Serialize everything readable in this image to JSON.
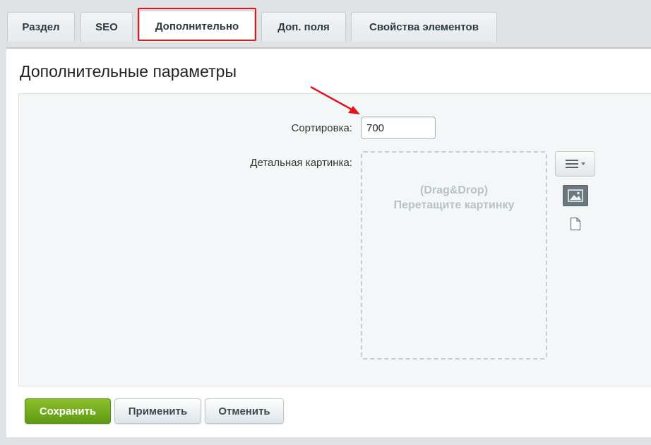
{
  "tabs": [
    {
      "label": "Раздел"
    },
    {
      "label": "SEO"
    },
    {
      "label": "Дополнительно"
    },
    {
      "label": "Доп. поля"
    },
    {
      "label": "Свойства элементов"
    }
  ],
  "active_tab": "Дополнительно",
  "panel": {
    "title": "Дополнительные параметры"
  },
  "form": {
    "sort_label": "Сортировка:",
    "sort_value": "700",
    "picture_label": "Детальная картинка:",
    "dropzone_line1": "(Drag&Drop)",
    "dropzone_line2": "Перетащите картинку"
  },
  "icons": {
    "menu": "hamburger-dropdown-icon",
    "image": "image-icon",
    "file": "file-icon"
  },
  "buttons": {
    "save": "Сохранить",
    "apply": "Применить",
    "cancel": "Отменить"
  },
  "colors": {
    "save_button": "#6aa51c",
    "highlight": "#e0161b",
    "arrow": "#e0161b"
  }
}
